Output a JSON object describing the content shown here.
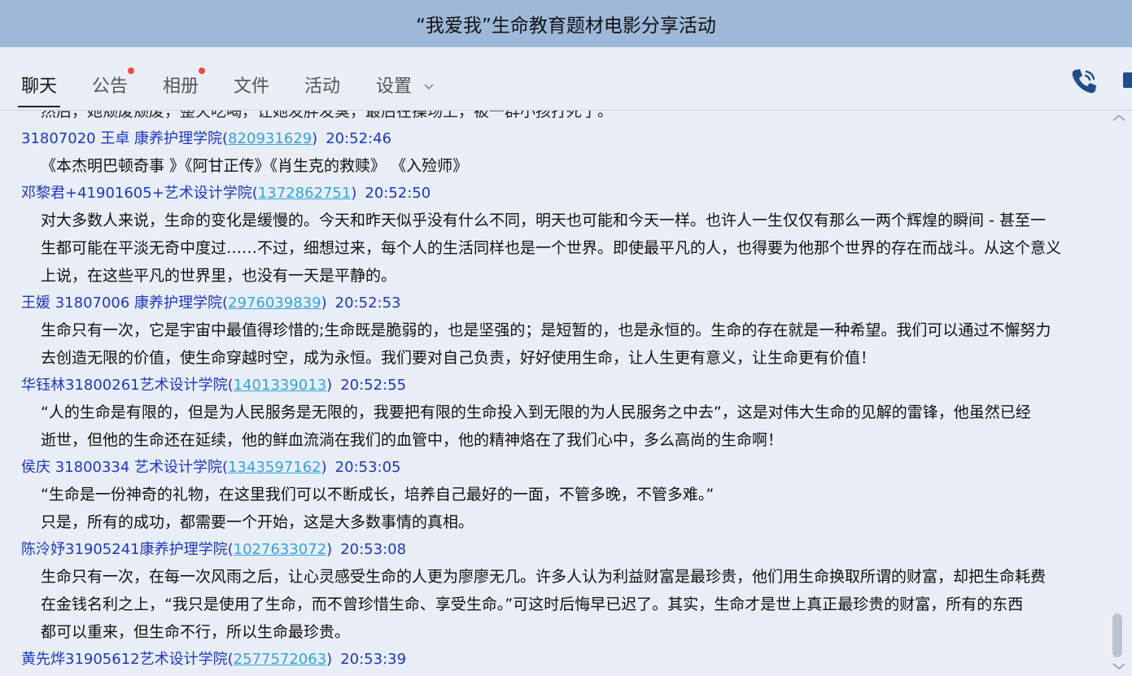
{
  "window": {
    "title": "“我爱我”生命教育题材电影分享活动"
  },
  "tabs": [
    {
      "label": "聊天",
      "active": true,
      "badge": false
    },
    {
      "label": "公告",
      "active": false,
      "badge": true
    },
    {
      "label": "相册",
      "active": false,
      "badge": true
    },
    {
      "label": "文件",
      "active": false,
      "badge": false
    },
    {
      "label": "活动",
      "active": false,
      "badge": false
    },
    {
      "label": "设置",
      "active": false,
      "badge": false,
      "has_dropdown": true
    }
  ],
  "toolbar_icons": [
    "phone-icon",
    "video-call-icon"
  ],
  "chat": {
    "cut_off_text": "然后，她颓废颓废，整天吃喝，让她发胖发臭，最后在操场上，被一群小孩打死了。",
    "messages": [
      {
        "sender": "31807020 王卓 康养护理学院(",
        "qq": "820931629",
        "close": ")",
        "time": "20:52:46",
        "lines": [
          "《本杰明巴顿奇事 》《阿甘正传》《肖生克的救赎》 《入殓师》"
        ]
      },
      {
        "sender": "邓黎君+41901605+艺术设计学院(",
        "qq": "1372862751",
        "close": ")",
        "time": "20:52:50",
        "lines": [
          "对大多数人来说，生命的变化是缓慢的。今天和昨天似乎没有什么不同，明天也可能和今天一样。也许人一生仅仅有那么一两个辉煌的瞬间 - 甚至一",
          "生都可能在平淡无奇中度过……不过，细想过来，每个人的生活同样也是一个世界。即使最平凡的人，也得要为他那个世界的存在而战斗。从这个意义",
          "上说，在这些平凡的世界里，也没有一天是平静的。"
        ]
      },
      {
        "sender": "王媛 31807006 康养护理学院(",
        "qq": "2976039839",
        "close": ")",
        "time": "20:52:53",
        "lines": [
          "生命只有一次，它是宇宙中最值得珍惜的;生命既是脆弱的，也是坚强的；是短暂的，也是永恒的。生命的存在就是一种希望。我们可以通过不懈努力",
          "去创造无限的价值，使生命穿越时空，成为永恒。我们要对自己负责，好好使用生命，让人生更有意义，让生命更有价值！"
        ]
      },
      {
        "sender": "华钰林31800261艺术设计学院(",
        "qq": "1401339013",
        "close": ")",
        "time": "20:52:55",
        "lines": [
          "“人的生命是有限的，但是为人民服务是无限的，我要把有限的生命投入到无限的为人民服务之中去”，这是对伟大生命的见解的雷锋，他虽然已经",
          "逝世，但他的生命还在延续，他的鲜血流淌在我们的血管中，他的精神烙在了我们心中，多么高尚的生命啊！"
        ]
      },
      {
        "sender": "侯庆  31800334  艺术设计学院(",
        "qq": "1343597162",
        "close": ")",
        "time": "20:53:05",
        "lines": [
          "“生命是一份神奇的礼物，在这里我们可以不断成长，培养自己最好的一面，不管多晚，不管多难。”",
          "只是，所有的成功，都需要一个开始，这是大多数事情的真相。"
        ]
      },
      {
        "sender": "陈泠妤31905241康养护理学院(",
        "qq": "1027633072",
        "close": ")",
        "time": "20:53:08",
        "lines": [
          "生命只有一次，在每一次风雨之后，让心灵感受生命的人更为廖廖无几。许多人认为利益财富是最珍贵，他们用生命换取所谓的财富，却把生命耗费",
          "在金钱名利之上，“我只是使用了生命，而不曾珍惜生命、享受生命。”可这时后悔早已迟了。其实，生命才是世上真正最珍贵的财富，所有的东西",
          "都可以重来，但生命不行，所以生命最珍贵。"
        ]
      },
      {
        "sender": "黄先烨31905612艺术设计学院(",
        "qq": "2577572063",
        "close": ")",
        "time": "20:53:39",
        "lines": []
      }
    ]
  },
  "colors": {
    "titlebar": "#9db9d9",
    "background": "#e9eef6",
    "sender": "#1d36c8",
    "qq_link": "#32a3e0",
    "badge": "#e84c3d",
    "phone_icon": "#1e4e8c"
  }
}
